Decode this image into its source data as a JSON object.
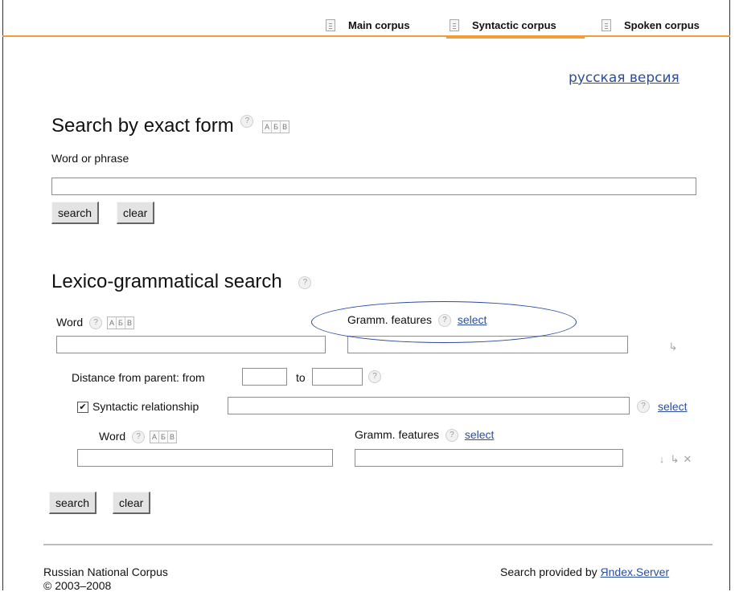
{
  "nav": {
    "tabs": [
      {
        "label": "Main corpus",
        "icon": "document-icon"
      },
      {
        "label": "Syntactic corpus",
        "icon": "document-icon",
        "active": true
      },
      {
        "label": "Spoken corpus",
        "icon": "document-icon"
      }
    ],
    "accent_color": "#f29c3a"
  },
  "lang_link": "русская версия",
  "exact": {
    "title": "Search by exact form",
    "help": "?",
    "keyboard": [
      "А",
      "Б",
      "В"
    ],
    "field_label": "Word or phrase",
    "value": "",
    "search_label": "search",
    "clear_label": "clear"
  },
  "lexgram": {
    "title": "Lexico-grammatical search",
    "help": "?",
    "word1": {
      "label": "Word",
      "help": "?",
      "keyboard": [
        "А",
        "Б",
        "В"
      ],
      "value": ""
    },
    "gramm1": {
      "label": "Gramm. features",
      "help": "?",
      "select": "select",
      "value": ""
    },
    "distance": {
      "label": "Distance from parent: from",
      "to_label": "to",
      "from_value": "",
      "to_value": "",
      "help": "?"
    },
    "syntactic": {
      "label": "Syntactic relationship",
      "checked": true,
      "help": "?",
      "select": "select",
      "value": ""
    },
    "word2": {
      "label": "Word",
      "help": "?",
      "keyboard": [
        "А",
        "Б",
        "В"
      ],
      "value": ""
    },
    "gramm2": {
      "label": "Gramm. features",
      "help": "?",
      "select": "select",
      "value": ""
    },
    "search_label": "search",
    "clear_label": "clear"
  },
  "footer": {
    "left_line1": "Russian National Corpus",
    "left_line2": "© 2003–2008",
    "right_prefix": "Search provided by",
    "right_link": "Яndex.Server"
  }
}
